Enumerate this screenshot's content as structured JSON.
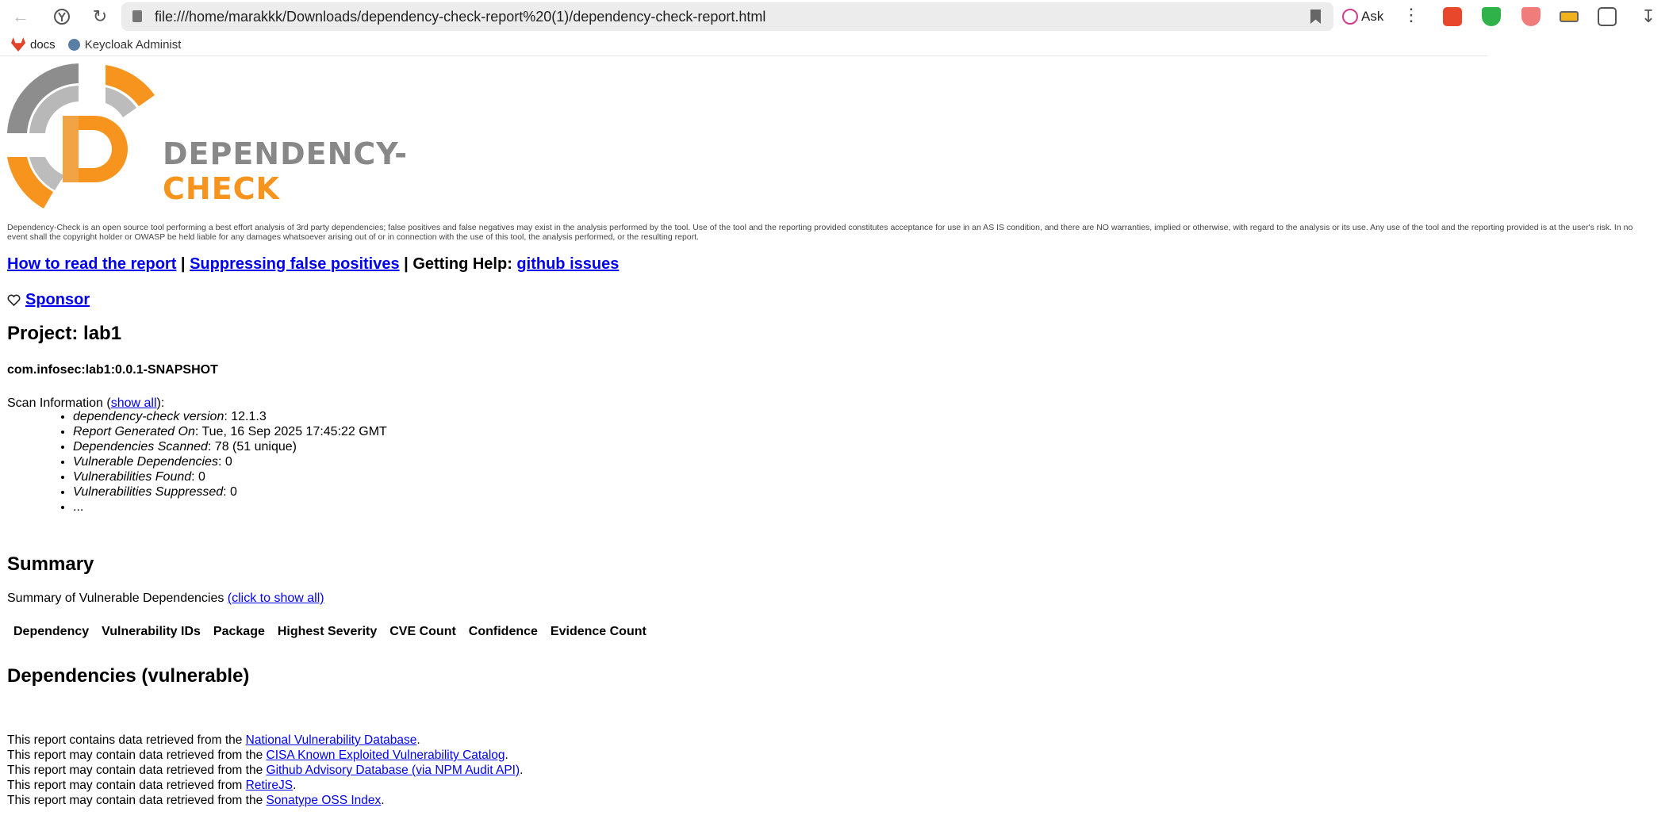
{
  "browser": {
    "url": "file:///home/marakkk/Downloads/dependency-check-report%20(1)/dependency-check-report.html",
    "ask_label": "Ask",
    "bookmarks": [
      {
        "label": "docs",
        "icon": "gitlab-icon"
      },
      {
        "label": "Keycloak Administ",
        "icon": "keycloak-icon"
      }
    ]
  },
  "logo": {
    "part1": "DEPENDENCY-",
    "part2": "CHECK",
    "colors": {
      "gray": "#888888",
      "orange": "#f7941d"
    }
  },
  "disclaimer": "Dependency-Check is an open source tool performing a best effort analysis of 3rd party dependencies; false positives and false negatives may exist in the analysis performed by the tool. Use of the tool and the reporting provided constitutes acceptance for use in an AS IS condition, and there are NO warranties, implied or otherwise, with regard to the analysis or its use. Any use of the tool and the reporting provided is at the user's risk. In no event shall the copyright holder or OWASP be held liable for any damages whatsoever arising out of or in connection with the use of this tool, the analysis performed, or the resulting report.",
  "links": {
    "how_to_read": "How to read the report",
    "sep1": " | ",
    "suppressing": "Suppressing false positives",
    "sep2": " | Getting Help: ",
    "github": "github issues"
  },
  "sponsor": "Sponsor",
  "project": {
    "title": "Project: lab1",
    "gav": "com.infosec:lab1:0.0.1-SNAPSHOT"
  },
  "scan": {
    "label_prefix": "Scan Information (",
    "show_all": "show all",
    "label_suffix": "):",
    "items": [
      {
        "key": "dependency-check version",
        "value": ": 12.1.3"
      },
      {
        "key": "Report Generated On",
        "value": ": Tue, 16 Sep 2025 17:45:22 GMT"
      },
      {
        "key": "Dependencies Scanned",
        "value": ": 78 (51 unique)"
      },
      {
        "key": "Vulnerable Dependencies",
        "value": ": 0"
      },
      {
        "key": "Vulnerabilities Found",
        "value": ": 0"
      },
      {
        "key": "Vulnerabilities Suppressed",
        "value": ": 0"
      },
      {
        "key": "",
        "value": "..."
      }
    ]
  },
  "summary": {
    "title": "Summary",
    "subtitle": "Summary of Vulnerable Dependencies ",
    "show_all": "(click to show all)",
    "columns": [
      "Dependency",
      "Vulnerability IDs",
      "Package",
      "Highest Severity",
      "CVE Count",
      "Confidence",
      "Evidence Count"
    ]
  },
  "vulnerable_title": "Dependencies (vulnerable)",
  "footer": [
    {
      "prefix": "This report contains data retrieved from the ",
      "link": "National Vulnerability Database",
      "suffix": "."
    },
    {
      "prefix": "This report may contain data retrieved from the ",
      "link": "CISA Known Exploited Vulnerability Catalog",
      "suffix": "."
    },
    {
      "prefix": "This report may contain data retrieved from the ",
      "link": "Github Advisory Database (via NPM Audit API)",
      "suffix": "."
    },
    {
      "prefix": "This report may contain data retrieved from ",
      "link": "RetireJS",
      "suffix": "."
    },
    {
      "prefix": "This report may contain data retrieved from the ",
      "link": "Sonatype OSS Index",
      "suffix": "."
    }
  ]
}
